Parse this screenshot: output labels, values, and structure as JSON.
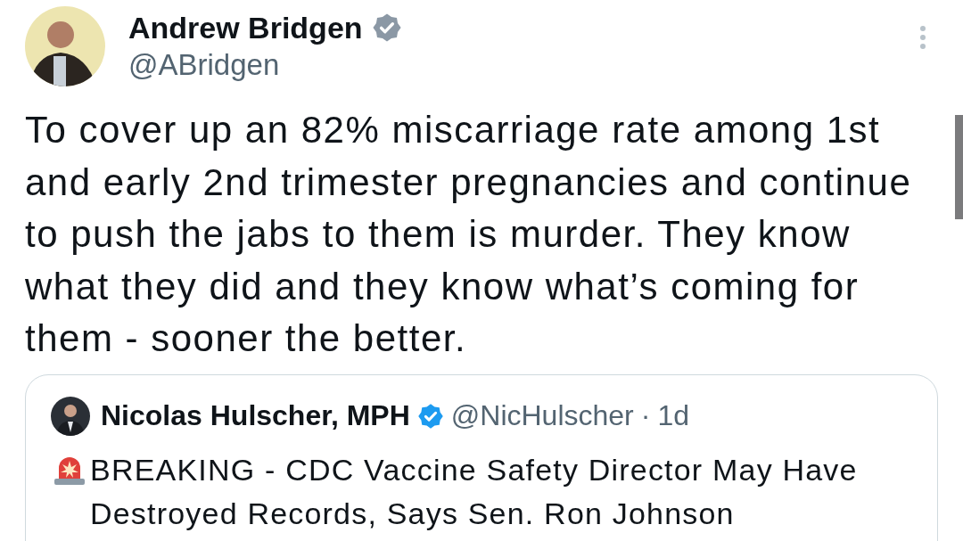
{
  "author": {
    "name": "Andrew Bridgen",
    "handle": "@ABridgen",
    "verified": true
  },
  "text": "To cover up an 82% miscarriage rate among 1st and early 2nd trimester pregnancies and continue to push the jabs to them is murder. They know what they did and they know what’s coming for them - sooner the better.",
  "quoted": {
    "name": "Nicolas Hulscher, MPH",
    "verified": true,
    "handle": "@NicHulscher",
    "separator": "·",
    "time": "1d",
    "text": "BREAKING - CDC Vaccine Safety Director May Have Destroyed Records, Says Sen. Ron Johnson"
  }
}
